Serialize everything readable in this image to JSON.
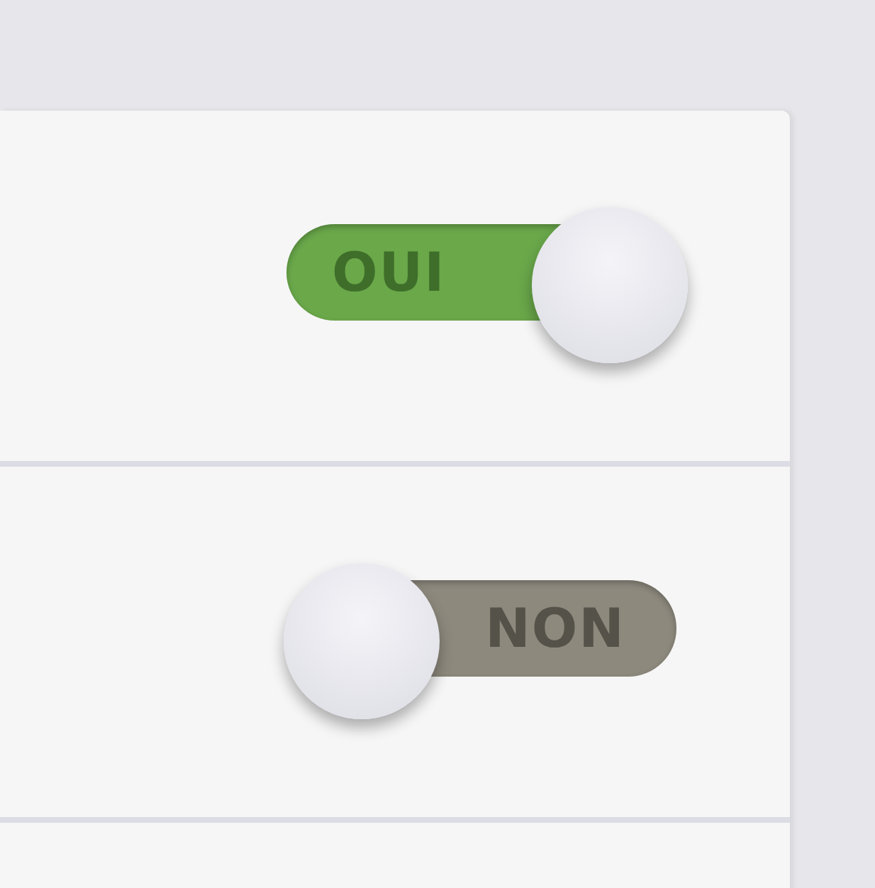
{
  "switches": [
    {
      "label": "OUI",
      "on": true
    },
    {
      "label": "NON",
      "on": false
    }
  ]
}
